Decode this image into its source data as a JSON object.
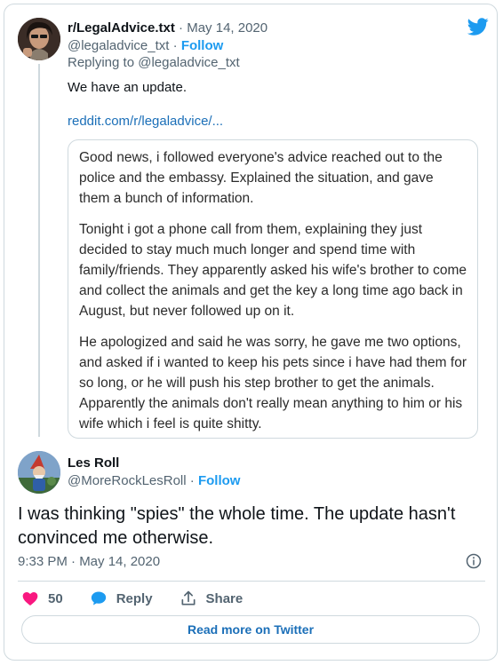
{
  "parent": {
    "name": "r/LegalAdvice.txt",
    "separator": "·",
    "date": "May 14, 2020",
    "handle": "@legaladvice_txt",
    "follow_label": "Follow",
    "replying_to": "Replying to @legaladvice_txt",
    "text": "We have an update.",
    "link": "reddit.com/r/legaladvice/..."
  },
  "quote": {
    "paragraphs": [
      "Good news, i followed everyone's advice reached out to the police and the embassy. Explained the situation, and gave them a bunch of information.",
      "Tonight i got a phone call from them, explaining they just decided to stay much much longer and spend time with family/friends. They apparently asked his wife's brother to come and collect the animals and get the key a long time ago back in August, but never followed up on it.",
      "He apologized and said he was sorry, he gave me two options, and asked if i wanted to keep his pets since i have had them for so long, or he will push his step brother to get the animals. Apparently the animals don't really mean anything to him or his wife which i feel is quite shitty."
    ]
  },
  "reply": {
    "name": "Les Roll",
    "handle": "@MoreRockLesRoll",
    "separator": "·",
    "follow_label": "Follow",
    "text": "I was thinking \"spies\" the whole time.  The update hasn't convinced me otherwise.",
    "timestamp": "9:33 PM · May 14, 2020"
  },
  "actions": {
    "like_count": "50",
    "reply_label": "Reply",
    "share_label": "Share"
  },
  "read_more_label": "Read more on Twitter",
  "colors": {
    "accent": "#1d9bf0",
    "link": "#1b6fb8",
    "like": "#f91880",
    "muted": "#536471",
    "border": "#cfd9de"
  },
  "icons": [
    "twitter-bird-icon",
    "info-icon",
    "heart-icon",
    "reply-bubble-icon",
    "share-icon"
  ]
}
